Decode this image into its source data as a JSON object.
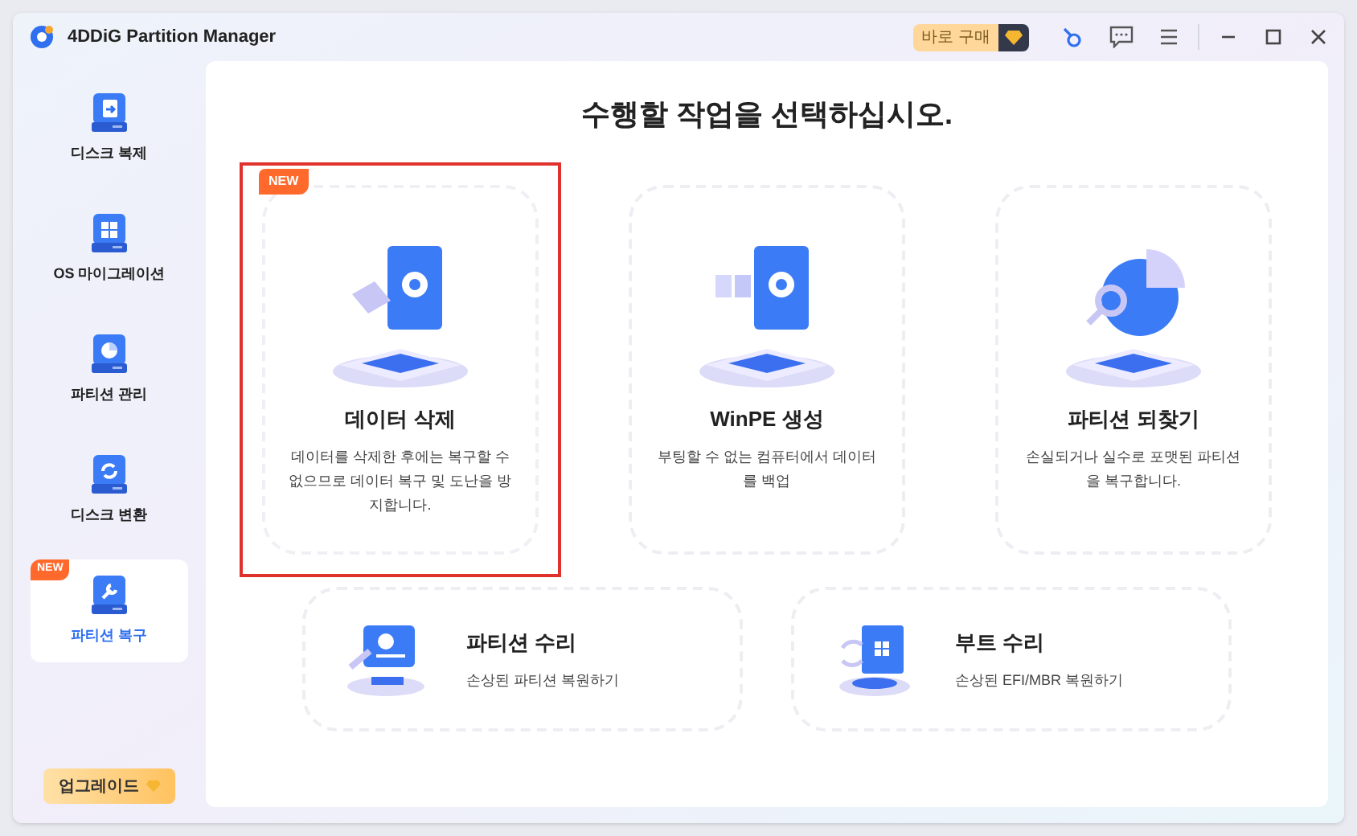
{
  "window": {
    "title": "4DDiG Partition Manager",
    "buy_label": "바로 구매"
  },
  "sidebar": {
    "items": [
      {
        "label": "디스크 복제",
        "kind": "copy",
        "selected": false
      },
      {
        "label": "OS 마이그레이션",
        "kind": "grid",
        "selected": false
      },
      {
        "label": "파티션 관리",
        "kind": "pie",
        "selected": false
      },
      {
        "label": "디스크 변환",
        "kind": "sync",
        "selected": false
      },
      {
        "label": "파티션 복구",
        "kind": "wrench",
        "selected": true,
        "badge": "NEW"
      }
    ],
    "upgrade": "업그레이드"
  },
  "main": {
    "heading": "수행할 작업을 선택하십시오.",
    "cards": [
      {
        "title": "데이터 삭제",
        "description": "데이터를 삭제한 후에는 복구할 수 없으므로 데이터 복구 및 도난을 방지합니다.",
        "kind": "erase",
        "selected": true,
        "badge": "NEW"
      },
      {
        "title": "WinPE 생성",
        "description": "부팅할 수 없는 컴퓨터에서 데이터를 백업",
        "kind": "winpe",
        "selected": false
      },
      {
        "title": "파티션 되찾기",
        "description": "손실되거나 실수로 포맷된 파티션을 복구합니다.",
        "kind": "find",
        "selected": false
      }
    ],
    "wide_cards": [
      {
        "title": "파티션 수리",
        "description": "손상된 파티션 복원하기",
        "kind": "repair",
        "selected": false
      },
      {
        "title": "부트 수리",
        "description": "손상된 EFI/MBR 복원하기",
        "kind": "boot",
        "selected": false
      }
    ]
  }
}
